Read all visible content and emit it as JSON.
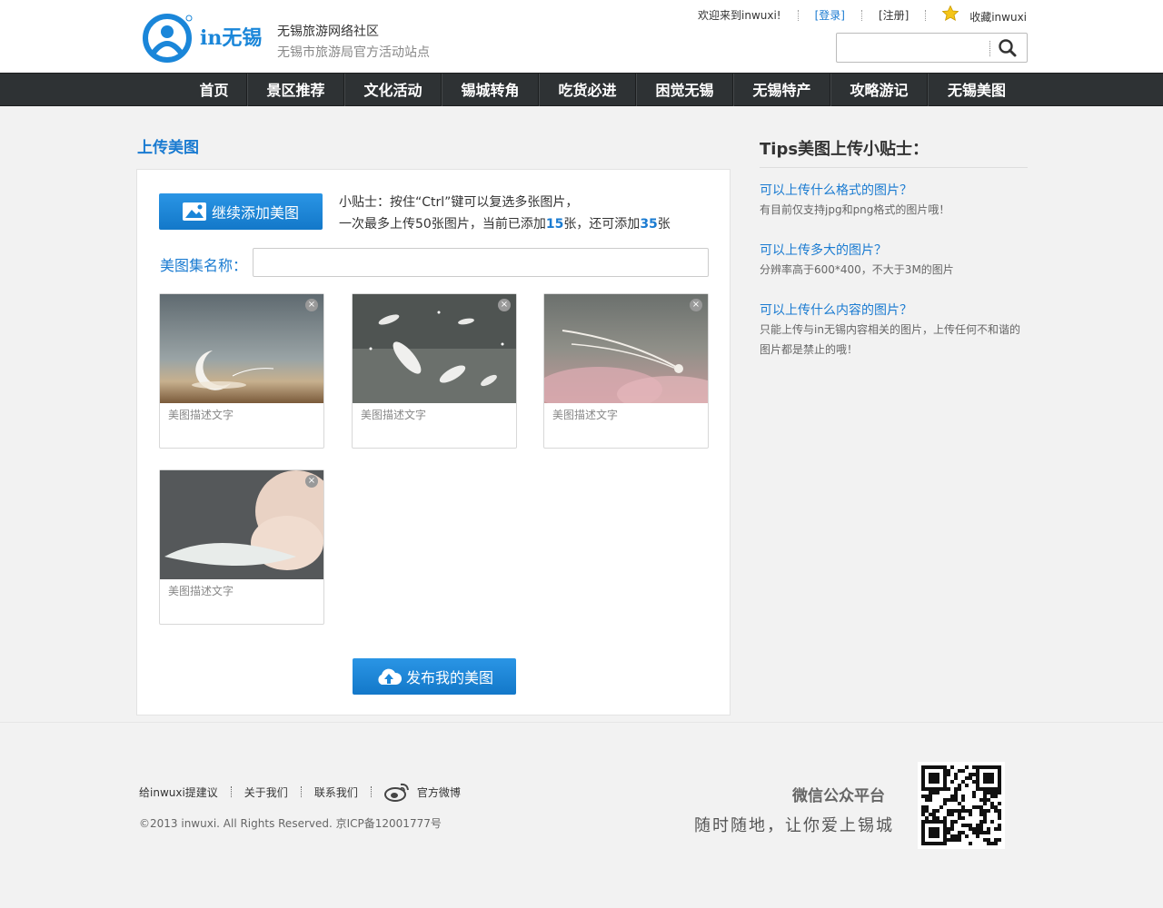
{
  "header": {
    "logo_text": "in无锡",
    "site_name": "无锡旅游网络社区",
    "site_sub": "无锡市旅游局官方活动站点",
    "welcome": "欢迎来到inwuxi!",
    "login": "[登录]",
    "register": "[注册]",
    "favorite": "收藏inwuxi",
    "search_placeholder": ""
  },
  "nav": {
    "items": [
      {
        "label": "首页"
      },
      {
        "label": "景区推荐"
      },
      {
        "label": "文化活动"
      },
      {
        "label": "锡城转角"
      },
      {
        "label": "吃货必进"
      },
      {
        "label": "困觉无锡"
      },
      {
        "label": "无锡特产"
      },
      {
        "label": "攻略游记"
      },
      {
        "label": "无锡美图"
      }
    ]
  },
  "main": {
    "title": "上传美图",
    "add_button": "继续添加美图",
    "tip_line1": "小贴士：按住“Ctrl”键可以复选多张图片，",
    "tip_line2_a": "一次最多上传50张图片，当前已添加",
    "added_count": "15",
    "tip_line2_b": "张，还可添加",
    "remaining_count": "35",
    "tip_line2_c": "张",
    "album_name_label": "美图集名称：",
    "album_name_value": "",
    "cards": [
      {
        "desc": "美图描述文字",
        "close": "×"
      },
      {
        "desc": "美图描述文字",
        "close": "×"
      },
      {
        "desc": "美图描述文字",
        "close": "×"
      },
      {
        "desc": "美图描述文字",
        "close": "×"
      }
    ],
    "publish_button": "发布我的美图"
  },
  "sidebar": {
    "title": "Tips美图上传小贴士：",
    "tips": [
      {
        "q": "可以上传什么格式的图片？",
        "a": "有目前仅支持jpg和png格式的图片哦！"
      },
      {
        "q": "可以上传多大的图片？",
        "a": "分辨率高于600*400，不大于3M的图片"
      },
      {
        "q": "可以上传什么内容的图片？",
        "a": "只能上传与in无锡内容相关的图片，上传任何不和谐的图片都是禁止的哦！"
      }
    ]
  },
  "footer": {
    "links": [
      "给inwuxi提建议",
      "关于我们",
      "联系我们"
    ],
    "weibo": "官方微博",
    "copyright": "©2013 inwuxi. All Rights Reserved. 京ICP备12001777号",
    "wechat_title": "微信公众平台",
    "slogan": "随时随地，让你爱上锡城"
  },
  "colors": {
    "accent": "#1a7bd1",
    "nav_bg": "#2e3234",
    "button": "#1a86d9"
  },
  "icons": [
    "logo-icon",
    "star-icon",
    "search-icon",
    "image-icon",
    "upload-cloud-icon",
    "weibo-icon",
    "qr-code"
  ]
}
